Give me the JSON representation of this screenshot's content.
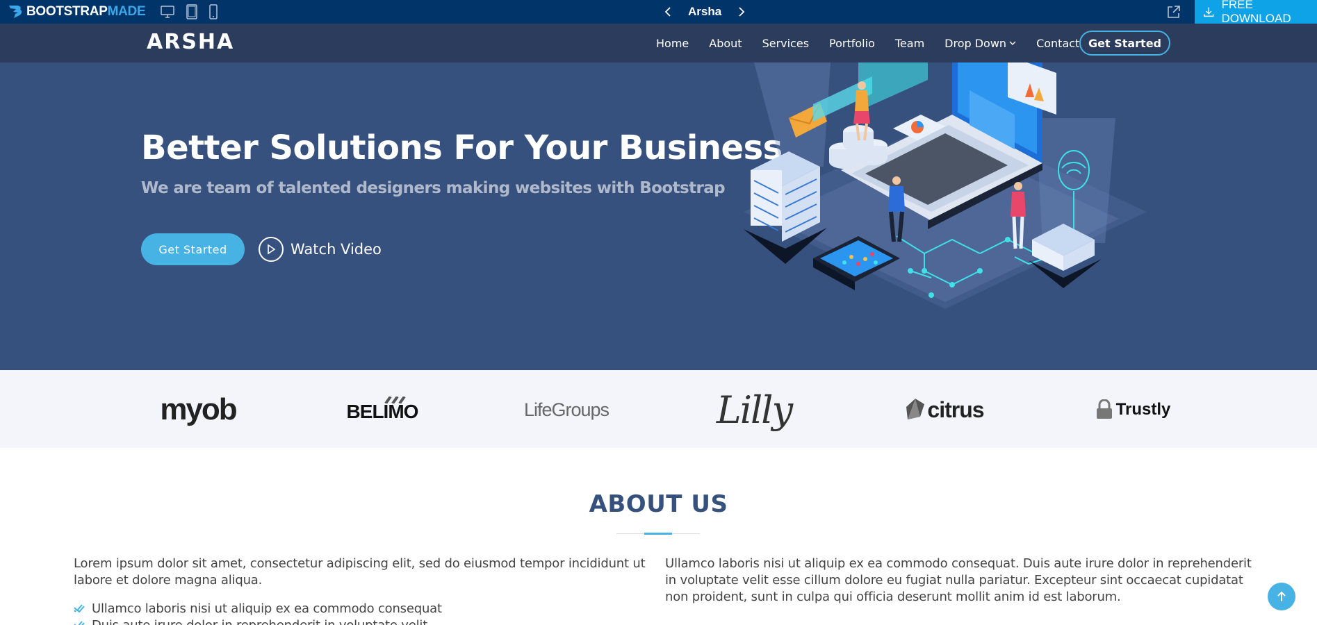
{
  "preview_bar": {
    "brand_main": "BOOTSTRAP",
    "brand_accent": "MADE",
    "theme_name": "Arsha",
    "download_label": "FREE DOWNLOAD",
    "device_icons": [
      "desktop-icon",
      "tablet-icon",
      "mobile-icon"
    ]
  },
  "header": {
    "brand": "ARSHA",
    "nav": [
      {
        "label": "Home"
      },
      {
        "label": "About"
      },
      {
        "label": "Services"
      },
      {
        "label": "Portfolio"
      },
      {
        "label": "Team"
      },
      {
        "label": "Drop Down"
      },
      {
        "label": "Contact"
      }
    ],
    "cta": "Get Started"
  },
  "hero": {
    "title": "Better Solutions For Your Business",
    "subtitle": "We are team of talented designers making websites with Bootstrap",
    "cta": "Get Started",
    "video_label": "Watch Video"
  },
  "clients": [
    "myob",
    "BELIMO",
    "LifeGroups",
    "Lilly",
    "citrus",
    "Trustly"
  ],
  "about": {
    "title": "ABOUT US",
    "left_text": "Lorem ipsum dolor sit amet, consectetur adipiscing elit, sed do eiusmod tempor incididunt ut labore et dolore magna aliqua.",
    "list": [
      "Ullamco laboris nisi ut aliquip ex ea commodo consequat",
      "Duis aute irure dolor in reprehenderit in voluptate velit"
    ],
    "right_text": "Ullamco laboris nisi ut aliquip ex ea commodo consequat. Duis aute irure dolor in reprehenderit in voluptate velit esse cillum dolore eu fugiat nulla pariatur. Excepteur sint occaecat cupidatat non proident, sunt in culpa qui officia deserunt mollit anim id est laborum."
  },
  "colors": {
    "preview_bar": "#013469",
    "header": "#2b3c5d",
    "hero": "#37517e",
    "accent": "#47b2e4",
    "download": "#0ea2e6",
    "clients_bg": "#f3f5fa"
  }
}
